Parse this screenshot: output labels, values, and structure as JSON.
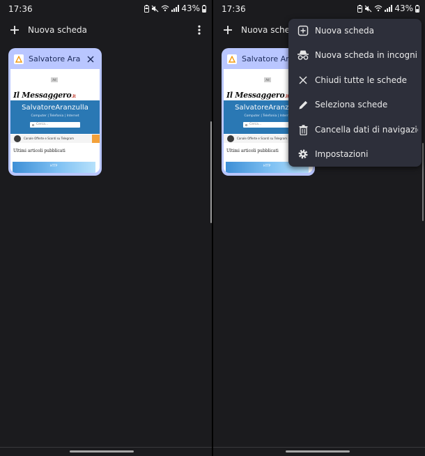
{
  "status_bar": {
    "time": "17:36",
    "battery_pct": "43%"
  },
  "toolbar": {
    "new_tab_label": "Nuova scheda"
  },
  "tab": {
    "title": "Salvatore Aranzulla",
    "thumbnail": {
      "ad_badge": "Ad",
      "masthead": "Il Messaggero",
      "masthead_suffix": ".it",
      "brand_name": "SalvatoreAranzulla",
      "nav": "Computer | Telefonia | Internet",
      "search_placeholder": "Cerca...",
      "telegram_text": "Canale Offerte e Sconti su Telegram",
      "articles_title": "Ultimi articoli pubblicati",
      "image_label": "HTTP"
    }
  },
  "menu": {
    "items": [
      {
        "label": "Nuova scheda",
        "icon": "add-box-icon"
      },
      {
        "label": "Nuova scheda in incogni...",
        "icon": "incognito-icon"
      },
      {
        "label": "Chiudi tutte le schede",
        "icon": "close-icon"
      },
      {
        "label": "Seleziona schede",
        "icon": "pencil-icon"
      },
      {
        "label": "Cancella dati di navigazio...",
        "icon": "trash-icon"
      },
      {
        "label": "Impostazioni",
        "icon": "gear-icon"
      }
    ]
  },
  "colors": {
    "background": "#1b1b1e",
    "tab_card": "#b9c6ff",
    "menu_bg": "#2d2f3a",
    "brand_band": "#2a78b4"
  }
}
